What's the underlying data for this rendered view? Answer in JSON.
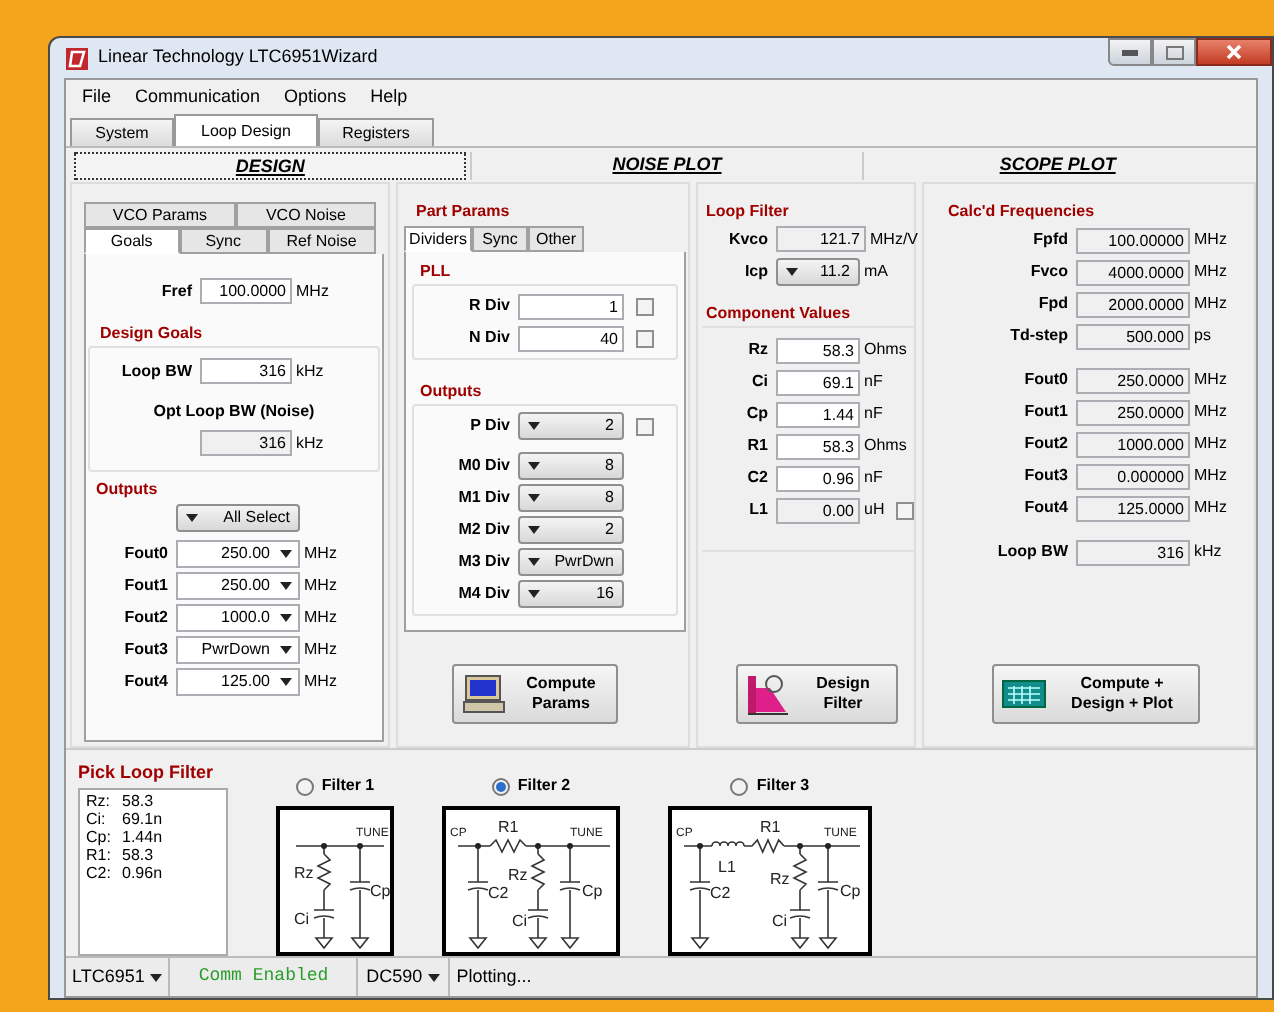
{
  "window": {
    "title": "Linear Technology LTC6951Wizard"
  },
  "menu": [
    "File",
    "Communication",
    "Options",
    "Help"
  ],
  "tabs": [
    {
      "label": "System",
      "selected": false
    },
    {
      "label": "Loop Design",
      "selected": true
    },
    {
      "label": "Registers",
      "selected": false
    }
  ],
  "view_tabs": [
    {
      "label": "DESIGN",
      "selected": true
    },
    {
      "label": "NOISE PLOT",
      "selected": false
    },
    {
      "label": "SCOPE PLOT",
      "selected": false
    }
  ],
  "goals_panel": {
    "tabs_row1": [
      {
        "label": "VCO Params",
        "selected": false
      },
      {
        "label": "VCO Noise",
        "selected": false
      }
    ],
    "tabs_row2": [
      {
        "label": "Goals",
        "selected": true
      },
      {
        "label": "Sync",
        "selected": false
      },
      {
        "label": "Ref Noise",
        "selected": false
      }
    ],
    "fref": {
      "label": "Fref",
      "value": "100.0000",
      "unit": "MHz"
    },
    "design_goals": {
      "title": "Design Goals",
      "loop_bw": {
        "label": "Loop BW",
        "value": "316",
        "unit": "kHz"
      },
      "opt_loop_bw": {
        "label": "Opt Loop BW (Noise)",
        "value": "316",
        "unit": "kHz"
      }
    },
    "outputs": {
      "title": "Outputs",
      "all_select": "All Select",
      "rows": [
        {
          "label": "Fout0",
          "value": "250.00",
          "unit": "MHz"
        },
        {
          "label": "Fout1",
          "value": "250.00",
          "unit": "MHz"
        },
        {
          "label": "Fout2",
          "value": "1000.0",
          "unit": "MHz"
        },
        {
          "label": "Fout3",
          "value": "PwrDown",
          "unit": "MHz"
        },
        {
          "label": "Fout4",
          "value": "125.00",
          "unit": "MHz"
        }
      ]
    }
  },
  "part_params": {
    "title": "Part Params",
    "tabs": [
      {
        "label": "Dividers",
        "selected": true
      },
      {
        "label": "Sync",
        "selected": false
      },
      {
        "label": "Other",
        "selected": false
      }
    ],
    "pll": {
      "title": "PLL",
      "rows": [
        {
          "label": "R Div",
          "value": "1",
          "checked": false
        },
        {
          "label": "N Div",
          "value": "40",
          "checked": false
        }
      ]
    },
    "outputs": {
      "title": "Outputs",
      "p_div": {
        "label": "P Div",
        "value": "2",
        "checked": false
      },
      "rows": [
        {
          "label": "M0 Div",
          "value": "8"
        },
        {
          "label": "M1 Div",
          "value": "8"
        },
        {
          "label": "M2 Div",
          "value": "2"
        },
        {
          "label": "M3 Div",
          "value": "PwrDwn"
        },
        {
          "label": "M4 Div",
          "value": "16"
        }
      ]
    },
    "button": "Compute Params"
  },
  "loop_filter": {
    "title": "Loop Filter",
    "kvco": {
      "label": "Kvco",
      "value": "121.7",
      "unit": "MHz/V"
    },
    "icp": {
      "label": "Icp",
      "value": "11.2",
      "unit": "mA"
    },
    "component_values": {
      "title": "Component Values",
      "rows": [
        {
          "label": "Rz",
          "value": "58.3",
          "unit": "Ohms"
        },
        {
          "label": "Ci",
          "value": "69.1",
          "unit": "nF"
        },
        {
          "label": "Cp",
          "value": "1.44",
          "unit": "nF"
        },
        {
          "label": "R1",
          "value": "58.3",
          "unit": "Ohms"
        },
        {
          "label": "C2",
          "value": "0.96",
          "unit": "nF"
        }
      ],
      "l1": {
        "label": "L1",
        "value": "0.00",
        "unit": "uH",
        "checked": false
      }
    },
    "button": "Design Filter"
  },
  "calc_frequencies": {
    "title": "Calc'd Frequencies",
    "rows": [
      {
        "label": "Fpfd",
        "value": "100.00000",
        "unit": "MHz"
      },
      {
        "label": "Fvco",
        "value": "4000.0000",
        "unit": "MHz"
      },
      {
        "label": "Fpd",
        "value": "2000.0000",
        "unit": "MHz"
      },
      {
        "label": "Td-step",
        "value": "500.000",
        "unit": "ps"
      }
    ],
    "outputs": [
      {
        "label": "Fout0",
        "value": "250.0000",
        "unit": "MHz"
      },
      {
        "label": "Fout1",
        "value": "250.0000",
        "unit": "MHz"
      },
      {
        "label": "Fout2",
        "value": "1000.000",
        "unit": "MHz"
      },
      {
        "label": "Fout3",
        "value": "0.000000",
        "unit": "MHz"
      },
      {
        "label": "Fout4",
        "value": "125.0000",
        "unit": "MHz"
      }
    ],
    "loop_bw": {
      "label": "Loop BW",
      "value": "316",
      "unit": "kHz"
    },
    "button": "Compute + Design + Plot"
  },
  "pick_loop_filter": {
    "title": "Pick Loop Filter",
    "summary": [
      {
        "label": "Rz:",
        "value": "58.3"
      },
      {
        "label": "Ci:",
        "value": "69.1n"
      },
      {
        "label": "Cp:",
        "value": "1.44n"
      },
      {
        "label": "R1:",
        "value": "58.3"
      },
      {
        "label": "C2:",
        "value": "0.96n"
      }
    ],
    "filters": [
      {
        "label": "Filter 1",
        "selected": false,
        "kind": "basic",
        "labels": [
          {
            "kind": "tune",
            "text": "TUNE"
          },
          {
            "kind": "rz",
            "text": "Rz"
          },
          {
            "kind": "ci",
            "text": "Ci"
          },
          {
            "kind": "cp",
            "text": "Cp"
          }
        ]
      },
      {
        "label": "Filter 2",
        "selected": true,
        "kind": "rc",
        "labels": [
          {
            "kind": "cpin",
            "text": "CP"
          },
          {
            "kind": "r1",
            "text": "R1"
          },
          {
            "kind": "tune",
            "text": "TUNE"
          },
          {
            "kind": "rz",
            "text": "Rz"
          },
          {
            "kind": "c2",
            "text": "C2"
          },
          {
            "kind": "ci",
            "text": "Ci"
          },
          {
            "kind": "cp",
            "text": "Cp"
          }
        ]
      },
      {
        "label": "Filter 3",
        "selected": false,
        "kind": "lrc",
        "labels": [
          {
            "kind": "cpin",
            "text": "CP"
          },
          {
            "kind": "r1",
            "text": "R1"
          },
          {
            "kind": "tune",
            "text": "TUNE"
          },
          {
            "kind": "l1",
            "text": "L1"
          },
          {
            "kind": "rz",
            "text": "Rz"
          },
          {
            "kind": "c2",
            "text": "C2"
          },
          {
            "kind": "ci",
            "text": "Ci"
          },
          {
            "kind": "cp",
            "text": "Cp"
          }
        ]
      }
    ]
  },
  "status_bar": {
    "device": "LTC6951",
    "comm": "Comm Enabled",
    "board": "DC590",
    "message": "Plotting..."
  }
}
